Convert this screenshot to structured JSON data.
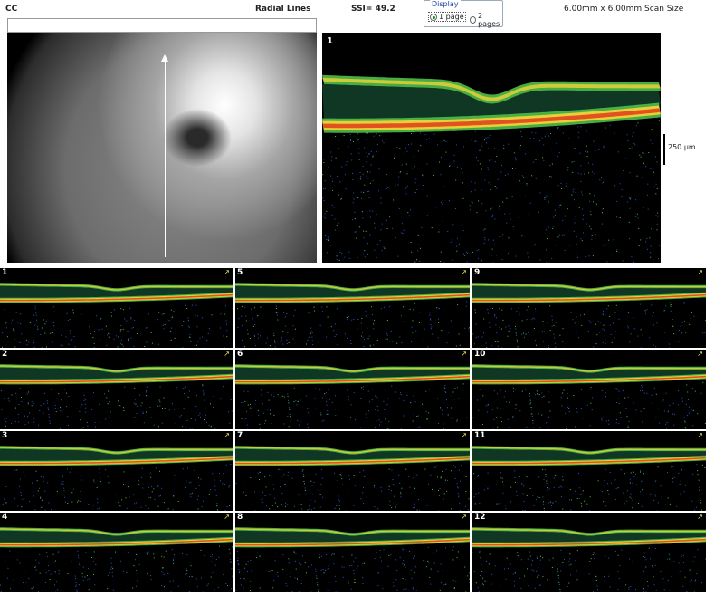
{
  "header": {
    "eye": "CC",
    "scan_type": "Radial Lines",
    "ssi": "SSI= 49.2",
    "scan_size": "6.00mm x 6.00mm Scan Size"
  },
  "display": {
    "legend": "Display",
    "option_1": "1 page",
    "option_2": "2 pages",
    "selected": "1 page"
  },
  "fundus": {
    "icon": "scan-direction-arrow"
  },
  "main_bscan": {
    "number": "1"
  },
  "scale": {
    "label": "250 μm"
  },
  "thumbnails": [
    {
      "n": "1"
    },
    {
      "n": "5"
    },
    {
      "n": "9"
    },
    {
      "n": "2"
    },
    {
      "n": "6"
    },
    {
      "n": "10"
    },
    {
      "n": "3"
    },
    {
      "n": "7"
    },
    {
      "n": "11"
    },
    {
      "n": "4"
    },
    {
      "n": "8"
    },
    {
      "n": "12"
    }
  ],
  "colors": {
    "retina_green": "#4fc04a",
    "rpe_red": "#e0441c",
    "rpe_yellow": "#f0d23a",
    "noise_blue": "#2b56c8"
  }
}
